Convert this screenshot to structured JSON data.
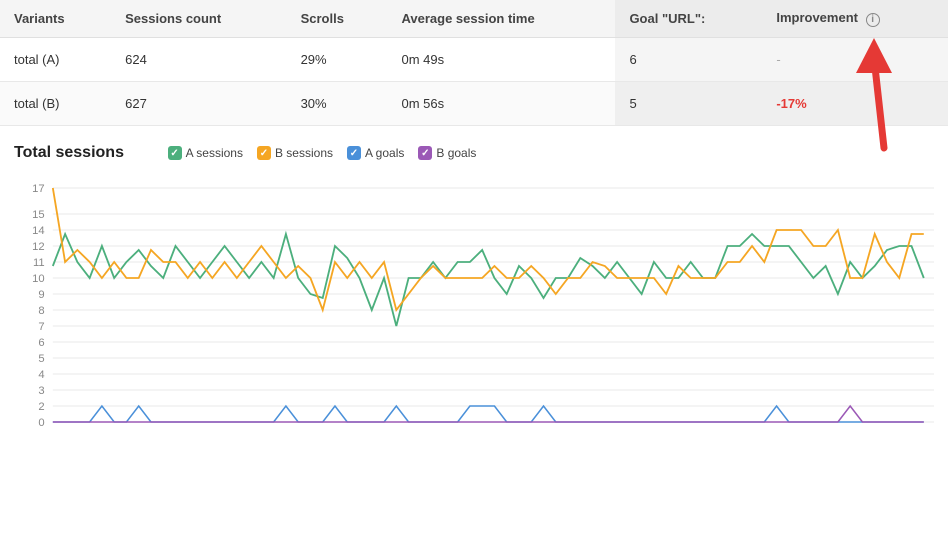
{
  "table": {
    "headers": [
      "Variants",
      "Sessions count",
      "Scrolls",
      "Average session time",
      "Goal \"URL\":",
      "Improvement"
    ],
    "rows": [
      {
        "variant": "total (A)",
        "sessions": "624",
        "scrolls": "29%",
        "avg_session": "0m 49s",
        "goal": "6",
        "improvement": "-",
        "improvement_type": "dash"
      },
      {
        "variant": "total (B)",
        "sessions": "627",
        "scrolls": "30%",
        "avg_session": "0m 56s",
        "goal": "5",
        "improvement": "-17%",
        "improvement_type": "negative"
      }
    ]
  },
  "chart": {
    "title": "Total sessions",
    "legend": [
      {
        "label": "A sessions",
        "color_class": "legend-check-green"
      },
      {
        "label": "B sessions",
        "color_class": "legend-check-orange"
      },
      {
        "label": "A goals",
        "color_class": "legend-check-blue"
      },
      {
        "label": "B goals",
        "color_class": "legend-check-purple"
      }
    ],
    "y_labels": [
      "17",
      "15",
      "14",
      "12",
      "11",
      "10",
      "9",
      "8",
      "7",
      "6",
      "5",
      "4",
      "3",
      "2",
      "0"
    ],
    "y_ticks": [
      0,
      2,
      3,
      4,
      5,
      6,
      7,
      8,
      9,
      10,
      11,
      12,
      14,
      15,
      17
    ],
    "colors": {
      "a_sessions": "#4caf7d",
      "b_sessions": "#f5a623",
      "a_goals": "#4a90d9",
      "b_goals": "#9b59b6"
    }
  }
}
